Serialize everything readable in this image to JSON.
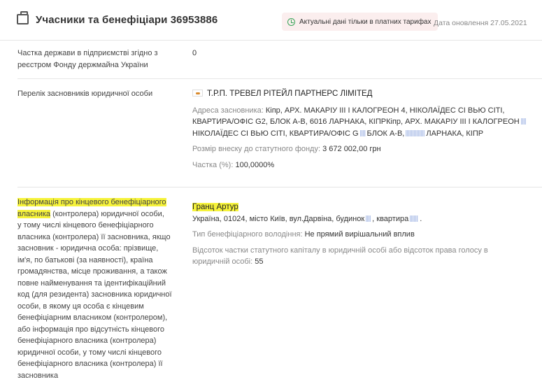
{
  "header": {
    "title": "Учасники та бенефіціари 36953886",
    "badge": "Актуальні дані тільки в платних тарифах",
    "updated": "Дата оновлення 27.05.2021"
  },
  "state_share": {
    "label": "Частка держави в підприємстві згідно з реєстром Фонду держмайна України",
    "value": "0"
  },
  "founders": {
    "label": "Перелік засновників юридичної особи",
    "company_name": "Т.Р.П. ТРЕВЕЛ РІТЕЙЛ ПАРТНЕРС ЛІМІТЕД",
    "address_label": "Адреса засновника:",
    "address_1": "Кіпр, АРХ. МАКАРІУ ІІІ І КАЛОГРЕОН 4, НІКОЛАЇДЕС СІ ВЬЮ СІТІ,",
    "address_2": "КВАРТИРА/ОФІС G2, БЛОК А-В, 6016 ЛАРНАКА, КІПРКіпр, АРХ. МАКАРІУ ІІІ І КАЛОГРЕОН",
    "address_3a": "НІКОЛАЇДЕС СІ ВЬЮ СІТІ, КВАРТИРА/ОФІС G",
    "address_3b": "БЛОК А-В,",
    "address_3c": "ЛАРНАКА, КІПР",
    "contribution_label": "Розмір внеску до статутного фонду:",
    "contribution_value": "3 672 002,00 грн",
    "share_label": "Частка (%):",
    "share_value": "100,0000%"
  },
  "beneficiary": {
    "label_hl_1": "Інформація про кінцевого бенефіціарного",
    "label_hl_2": "власника",
    "label_rest_1": " (контролера) юридичної особи,",
    "label_rest": "у тому числі кінцевого бенефіціарного власника (контролера) її засновника, якщо засновник - юридична особа: прізвище, ім'я, по батькові (за наявності), країна громадянства, місце проживання, а також повне найменування та ідентифікаційний код (для резидента) засновника юридичної особи, в якому ця особа є кінцевим бенефіціарним власником (контролером), або інформація про відсутність кінцевого бенефіціарного власника (контролера) юридичної особи, у тому числі кінцевого бенефіціарного власника (контролера) її засновника",
    "name": "Гранц Артур",
    "address_a": "Україна, 01024, місто Київ, вул.Дарвіна, будинок",
    "address_b": ", квартира",
    "address_c": ".",
    "ownership_type_label": "Тип бенефіціарного володіння:",
    "ownership_type_value": "Не прямий вирішальний вплив",
    "percent_label": "Відсоток частки статутного капіталу в юридичній особі або відсоток права голосу в юридичній особі:",
    "percent_value": "55"
  }
}
